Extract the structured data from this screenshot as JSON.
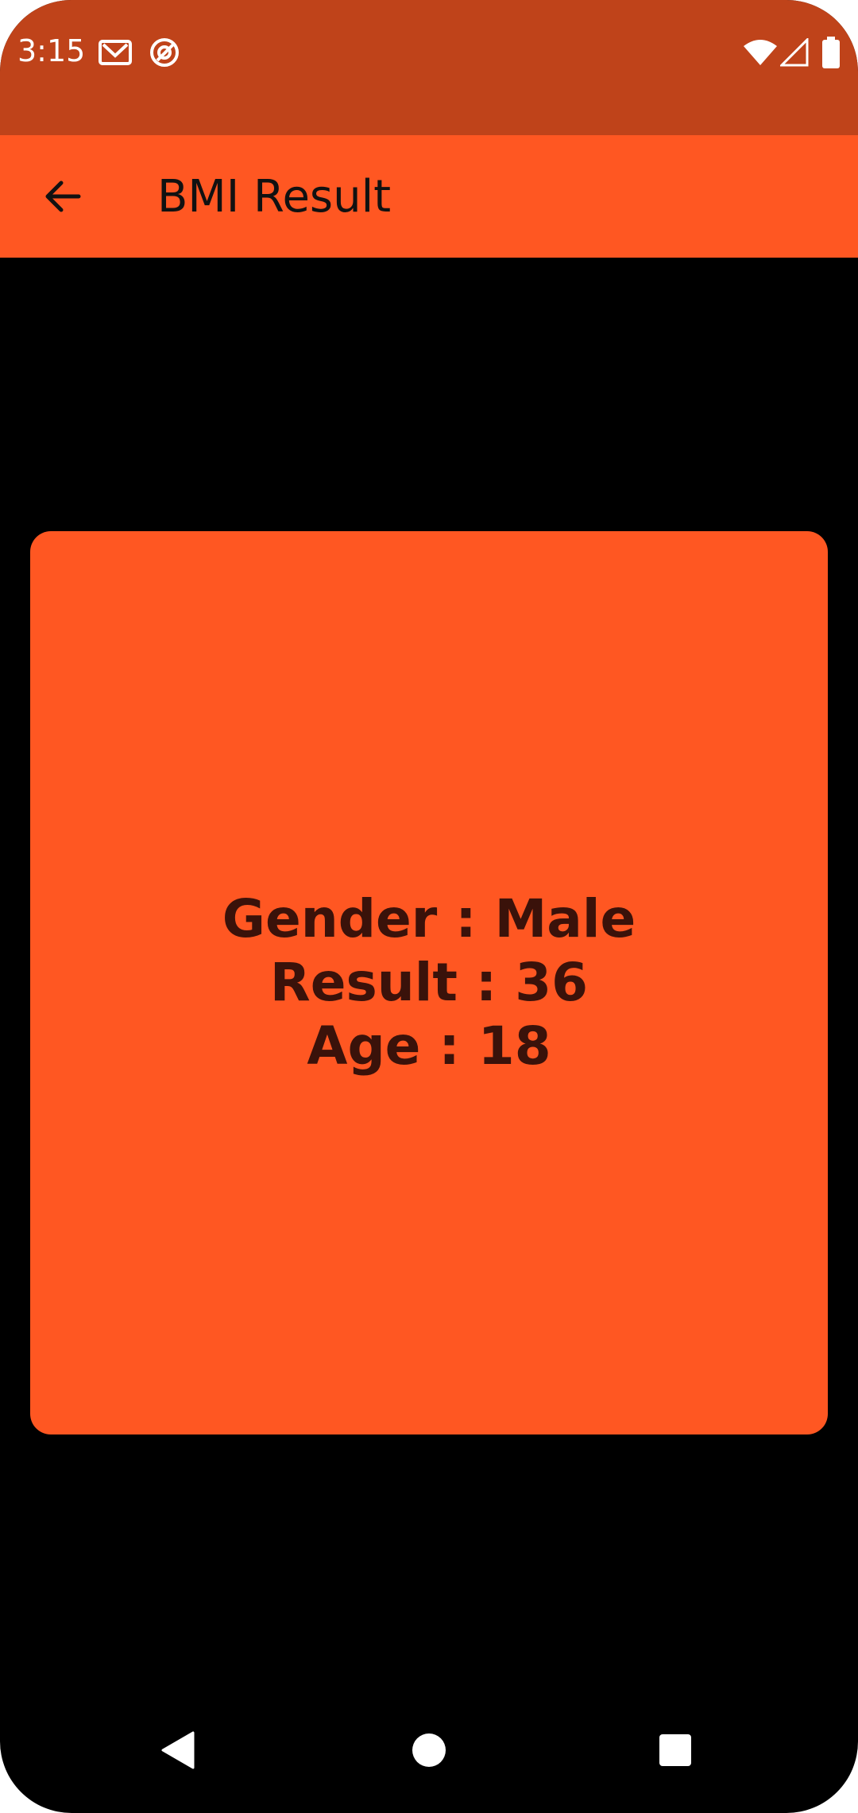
{
  "status_bar": {
    "time": "3:15",
    "icons": [
      "gmail-icon",
      "at-sign-icon",
      "wifi-icon",
      "cell-signal-icon",
      "battery-icon"
    ]
  },
  "app_bar": {
    "title": "BMI Result",
    "back_icon": "arrow-back-icon"
  },
  "result": {
    "gender_line": "Gender : Male",
    "result_line": "Result : 36",
    "age_line": "Age : 18"
  },
  "nav_bar": {
    "icons": [
      "back-triangle-icon",
      "home-circle-icon",
      "recents-square-icon"
    ]
  },
  "colors": {
    "status_bar": "#BF431A",
    "primary": "#FF5722",
    "background": "#000000",
    "card_text": "#3A120A"
  }
}
